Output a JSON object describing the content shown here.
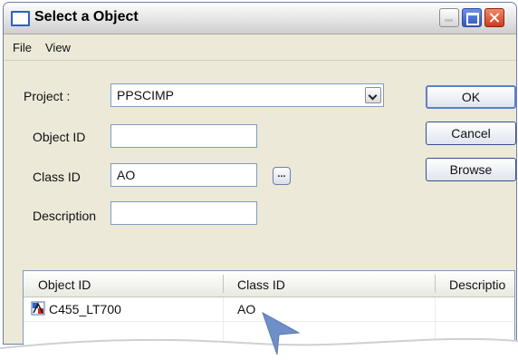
{
  "window": {
    "title": "Select a Object"
  },
  "menu": [
    "File",
    "View"
  ],
  "form": {
    "project_label": "Project :",
    "project_value": "PPSCIMP",
    "object_id_label": "Object ID",
    "object_id_value": "",
    "class_id_label": "Class ID",
    "class_id_value": "AO",
    "description_label": "Description",
    "description_value": "",
    "browse_dots_label": "..."
  },
  "buttons": {
    "ok": "OK",
    "cancel": "Cancel",
    "browse": "Browse"
  },
  "results": {
    "columns": [
      "Object ID",
      "Class ID",
      "Descriptio"
    ],
    "rows": [
      {
        "object_id": "C455_LT700",
        "class_id": "AO",
        "description": ""
      }
    ]
  },
  "colors": {
    "window_face": "#ece9d8",
    "title_accent": "#2b5fc4",
    "pointer": "#6f8fc9"
  }
}
